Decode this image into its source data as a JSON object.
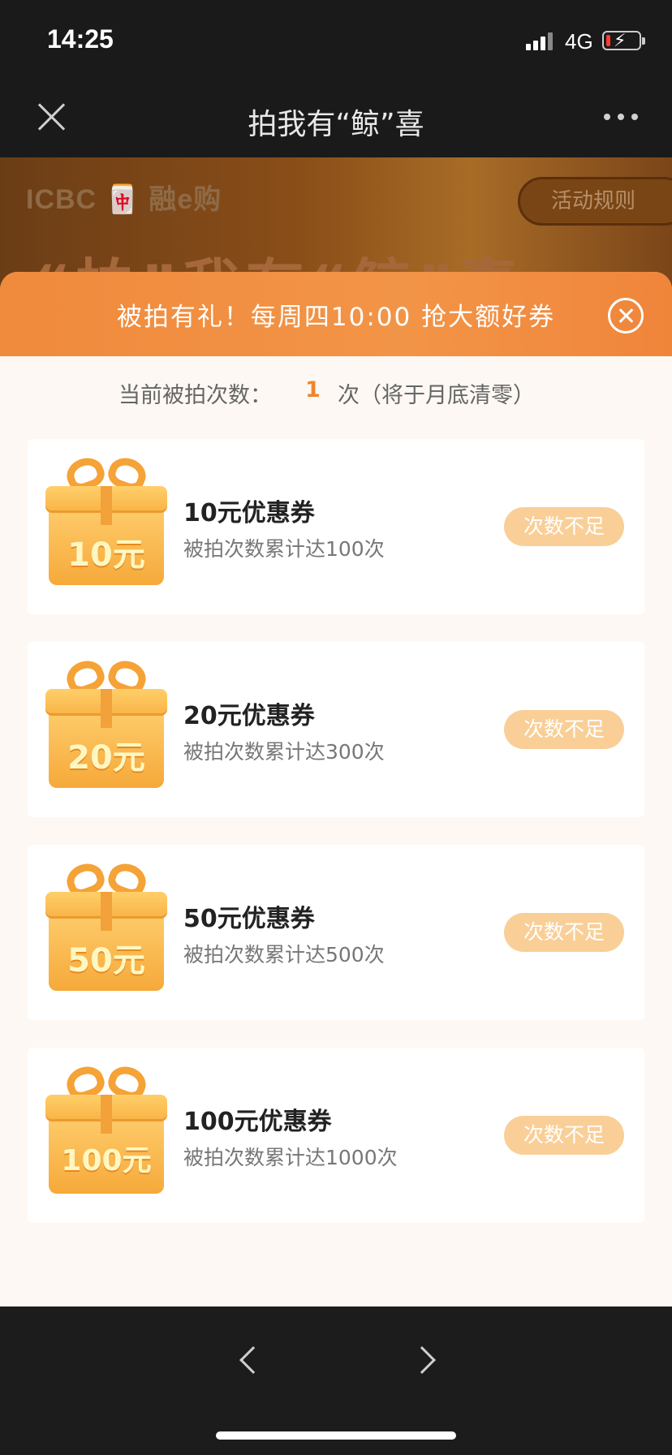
{
  "status_bar": {
    "time": "14:25",
    "network": "4G",
    "battery_level": 0.1,
    "charging": true
  },
  "nav": {
    "title": "拍我有“鲸”喜",
    "close_icon": "close-icon",
    "more_icon": "more-dots-icon"
  },
  "banner": {
    "logo_text": "ICBC 🀄 融e购",
    "rules_button": "活动规则",
    "headline": "“拍”我有“鲸”喜"
  },
  "popup": {
    "header_text": "被拍有礼！每周四10:00 抢大额好券",
    "count_label": "当前被拍次数：",
    "count_value": "1",
    "count_unit": "次（将于月底清零）",
    "coupons": [
      {
        "gift_label": "10元",
        "title": "10元优惠券",
        "desc": "被拍次数累计达100次",
        "button": "次数不足"
      },
      {
        "gift_label": "20元",
        "title": "20元优惠券",
        "desc": "被拍次数累计达300次",
        "button": "次数不足"
      },
      {
        "gift_label": "50元",
        "title": "50元优惠券",
        "desc": "被拍次数累计达500次",
        "button": "次数不足"
      },
      {
        "gift_label": "100元",
        "title": "100元优惠券",
        "desc": "被拍次数累计达1000次",
        "button": "次数不足"
      }
    ]
  },
  "colors": {
    "accent": "#f08a3c",
    "button_disabled": "#f9cf97",
    "count_highlight": "#f0852f"
  }
}
